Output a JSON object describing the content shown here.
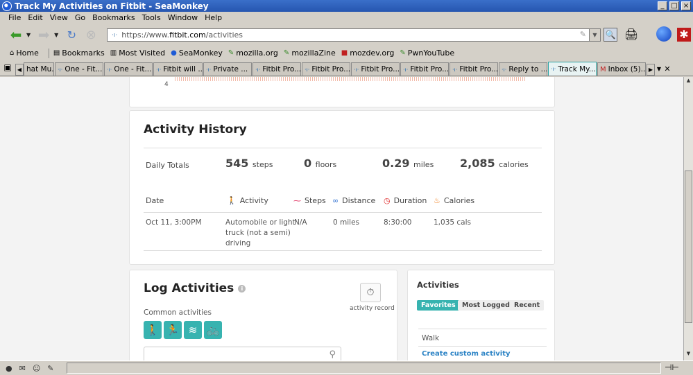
{
  "window": {
    "title": "Track My Activities on Fitbit - SeaMonkey",
    "controls": [
      "_",
      "□",
      "×"
    ]
  },
  "menu": [
    "File",
    "Edit",
    "View",
    "Go",
    "Bookmarks",
    "Tools",
    "Window",
    "Help"
  ],
  "nav": {
    "url_prefix": "https://www.",
    "url_domain": "fitbit.com",
    "url_path": "/activities"
  },
  "bookmarks": [
    "Home",
    "Bookmarks",
    "Most Visited",
    "SeaMonkey",
    "mozilla.org",
    "mozillaZine",
    "mozdev.org",
    "PwnYouTube"
  ],
  "tabs": [
    {
      "label": "hat Mu..."
    },
    {
      "label": "One - Fit..."
    },
    {
      "label": "One - Fit..."
    },
    {
      "label": "Fitbit will ..."
    },
    {
      "label": "Private ..."
    },
    {
      "label": "Fitbit Pro..."
    },
    {
      "label": "Fitbit Pro..."
    },
    {
      "label": "Fitbit Pro..."
    },
    {
      "label": "Fitbit Pro..."
    },
    {
      "label": "Fitbit Pro..."
    },
    {
      "label": "Reply to ..."
    },
    {
      "label": "Track My..."
    },
    {
      "label": "Inbox (5)..."
    }
  ],
  "chart": {
    "tick": "4"
  },
  "history": {
    "title": "Activity History",
    "daily_label": "Daily Totals",
    "steps": "545",
    "steps_unit": "steps",
    "floors": "0",
    "floors_unit": "floors",
    "miles": "0.29",
    "miles_unit": "miles",
    "calories": "2,085",
    "calories_unit": "calories",
    "headers": {
      "date": "Date",
      "activity": "Activity",
      "steps": "Steps",
      "distance": "Distance",
      "duration": "Duration",
      "calories": "Calories"
    },
    "rows": [
      {
        "date": "Oct 11, 3:00PM",
        "activity_1": "Automobile or light",
        "activity_2": "truck (not a semi)",
        "activity_3": "driving",
        "steps": "N/A",
        "distance": "0 miles",
        "duration": "8:30:00",
        "calories": "1,035 cals"
      }
    ]
  },
  "log": {
    "title": "Log Activities",
    "common_label": "Common activities",
    "record_label": "activity record",
    "accent": "#37b3b0"
  },
  "activities_panel": {
    "title": "Activities",
    "tabs": [
      "Favorites",
      "Most Logged",
      "Recent"
    ],
    "items": [
      "Walk"
    ],
    "create_link": "Create custom activity"
  }
}
